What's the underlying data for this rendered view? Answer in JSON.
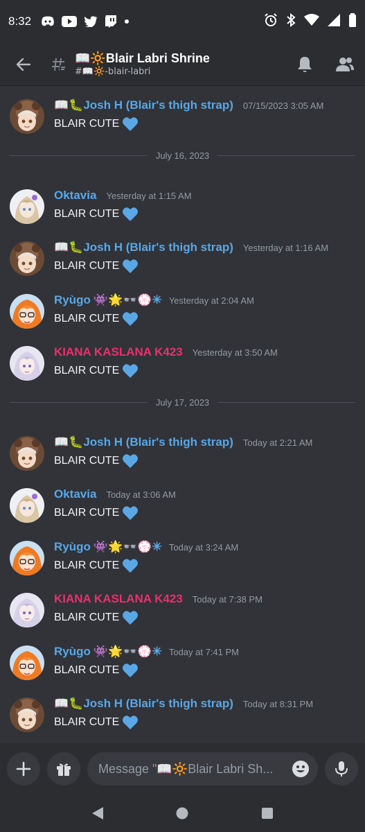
{
  "status_bar": {
    "time": "8:32",
    "notification_icons": [
      "discord-icon",
      "youtube-icon",
      "twitter-icon",
      "twitch-icon",
      "dot-icon"
    ],
    "system_icons": [
      "alarm-icon",
      "bluetooth-icon",
      "wifi-icon",
      "signal-icon",
      "battery-icon"
    ]
  },
  "header": {
    "back_icon": "arrow-left-icon",
    "channel_icon": "thread-hash-icon",
    "title": "📖🔆Blair Labri Shrine",
    "subtitle": "#📖🔆-blair-labri",
    "bell_icon": "bell-icon",
    "members_icon": "members-icon"
  },
  "colors": {
    "background": "#313338",
    "bar": "#2b2d31",
    "blue_name": "#5aa7e6",
    "pink_name": "#e8316b",
    "heart": "#5aa7e6"
  },
  "messages": [
    {
      "author_prefix": "📖🐛",
      "author": "Josh H (Blair's thigh strap)",
      "author_suffix": "",
      "color": "#5aa7e6",
      "timestamp": "07/15/2023 3:05 AM",
      "text": "BLAIR CUTE",
      "avatar": "josh"
    },
    {
      "divider": "July 16, 2023"
    },
    {
      "author_prefix": "",
      "author": "Oktavia",
      "author_suffix": "",
      "color": "#5aa7e6",
      "timestamp": "Yesterday at 1:15 AM",
      "text": "BLAIR CUTE",
      "avatar": "oktavia"
    },
    {
      "author_prefix": "📖🐛",
      "author": "Josh H (Blair's thigh strap)",
      "author_suffix": "",
      "color": "#5aa7e6",
      "timestamp": "Yesterday at 1:16 AM",
      "text": "BLAIR CUTE",
      "avatar": "josh"
    },
    {
      "author_prefix": "",
      "author": "Ryùgo",
      "author_suffix": "👾🌟👓💮✳",
      "color": "#5aa7e6",
      "timestamp": "Yesterday at 2:04 AM",
      "text": "BLAIR CUTE",
      "avatar": "ryugo"
    },
    {
      "author_prefix": "",
      "author": "KIANA KASLANA K423",
      "author_suffix": "",
      "color": "#e8316b",
      "timestamp": "Yesterday at 3:50 AM",
      "text": "BLAIR CUTE",
      "avatar": "kiana"
    },
    {
      "divider": "July 17, 2023"
    },
    {
      "author_prefix": "📖🐛",
      "author": "Josh H (Blair's thigh strap)",
      "author_suffix": "",
      "color": "#5aa7e6",
      "timestamp": "Today at 2:21 AM",
      "text": "BLAIR CUTE",
      "avatar": "josh"
    },
    {
      "author_prefix": "",
      "author": "Oktavia",
      "author_suffix": "",
      "color": "#5aa7e6",
      "timestamp": "Today at 3:06 AM",
      "text": "BLAIR CUTE",
      "avatar": "oktavia"
    },
    {
      "author_prefix": "",
      "author": "Ryùgo",
      "author_suffix": "👾🌟👓💮✳",
      "color": "#5aa7e6",
      "timestamp": "Today at 3:24 AM",
      "text": "BLAIR CUTE",
      "avatar": "ryugo"
    },
    {
      "author_prefix": "",
      "author": "KIANA KASLANA K423",
      "author_suffix": "",
      "color": "#e8316b",
      "timestamp": "Today at 7:38 PM",
      "text": "BLAIR CUTE",
      "avatar": "kiana"
    },
    {
      "author_prefix": "",
      "author": "Ryùgo",
      "author_suffix": "👾🌟👓💮✳",
      "color": "#5aa7e6",
      "timestamp": "Today at 7:41 PM",
      "text": "BLAIR CUTE",
      "avatar": "ryugo"
    },
    {
      "author_prefix": "📖🐛",
      "author": "Josh H (Blair's thigh strap)",
      "author_suffix": "",
      "color": "#5aa7e6",
      "timestamp": "Today at 8:31 PM",
      "text": "BLAIR CUTE",
      "avatar": "josh"
    }
  ],
  "composer": {
    "plus_icon": "plus-icon",
    "gift_icon": "gift-icon",
    "placeholder": "Message \"📖🔆Blair Labri Sh...",
    "emoji_icon": "emoji-icon",
    "mic_icon": "microphone-icon"
  },
  "nav_bar": {
    "back_icon": "nav-back-triangle-icon",
    "home_icon": "nav-home-circle-icon",
    "recents_icon": "nav-recents-square-icon"
  }
}
